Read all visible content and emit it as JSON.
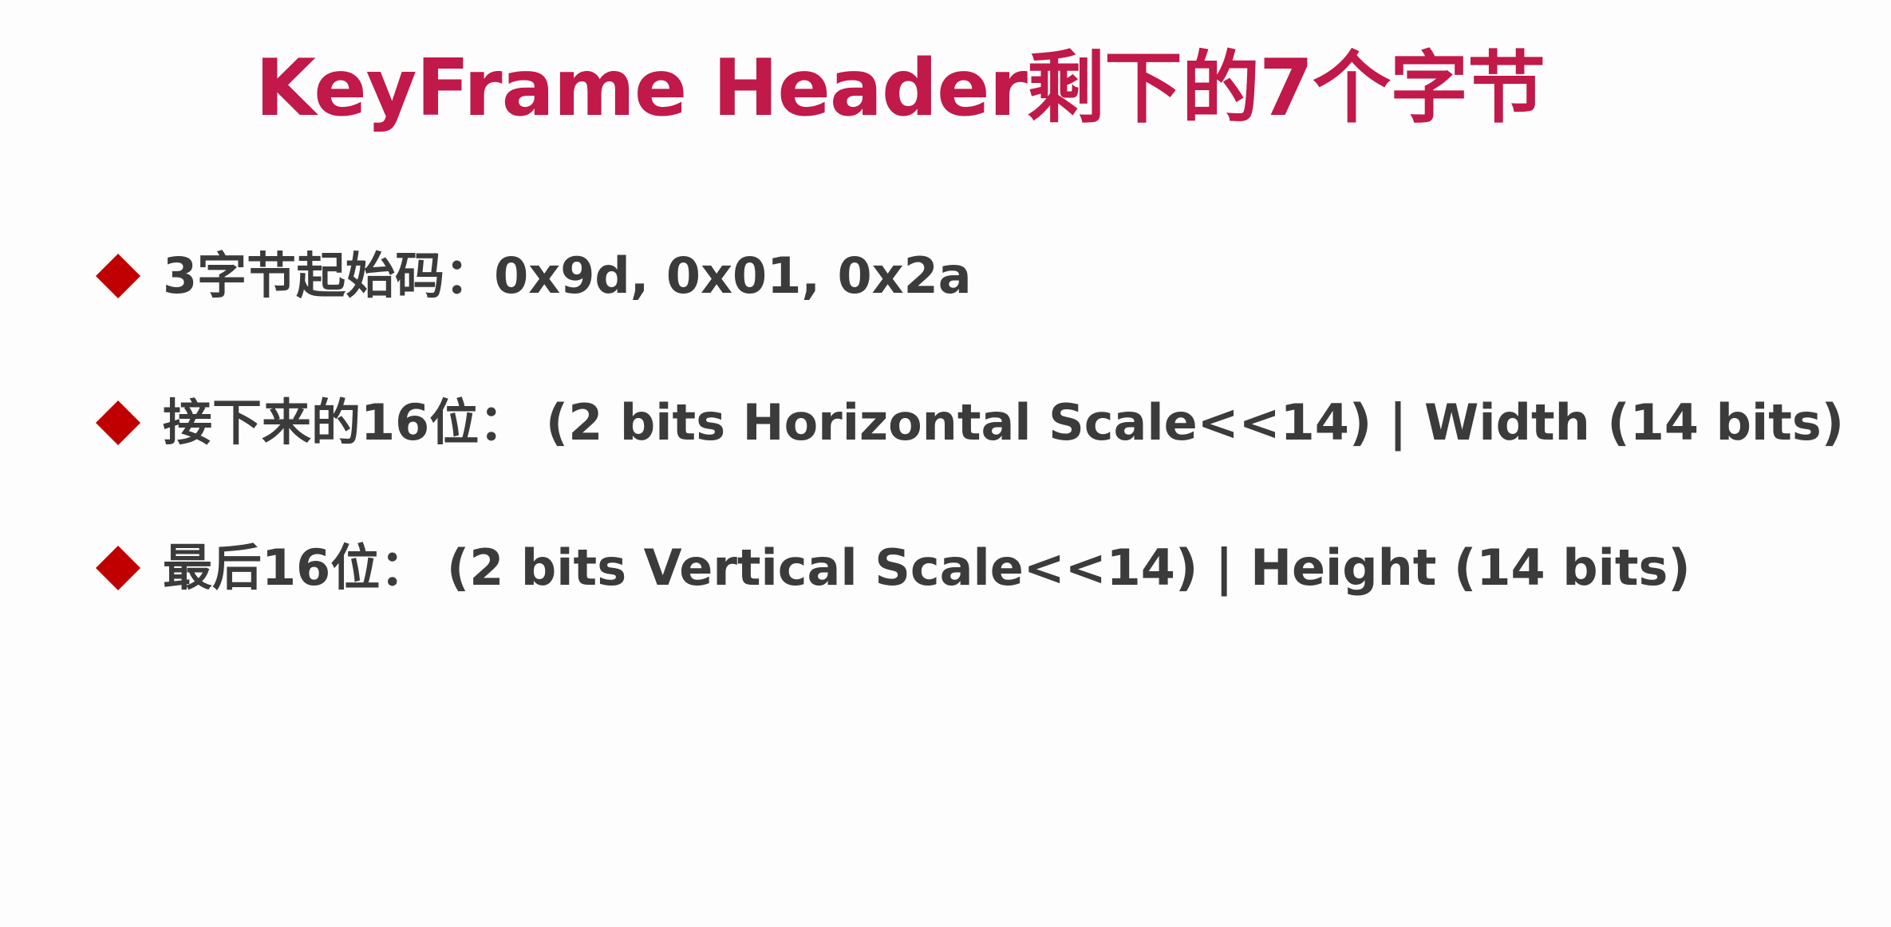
{
  "slide": {
    "title": "KeyFrame Header剩下的7个字节",
    "bullets": [
      {
        "icon": "diamond-bullet-icon",
        "text": "3字节起始码：0x9d, 0x01, 0x2a"
      },
      {
        "icon": "diamond-bullet-icon",
        "text": "接下来的16位： (2 bits Horizontal Scale<<14) | Width (14 bits)"
      },
      {
        "icon": "diamond-bullet-icon",
        "text": "最后16位： (2 bits Vertical Scale<<14) | Height (14 bits)"
      }
    ]
  },
  "colors": {
    "title": "#c0194a",
    "bullet_marker": "#c00000",
    "body_text": "#3b3b3b",
    "background": "#fdfdfd"
  }
}
